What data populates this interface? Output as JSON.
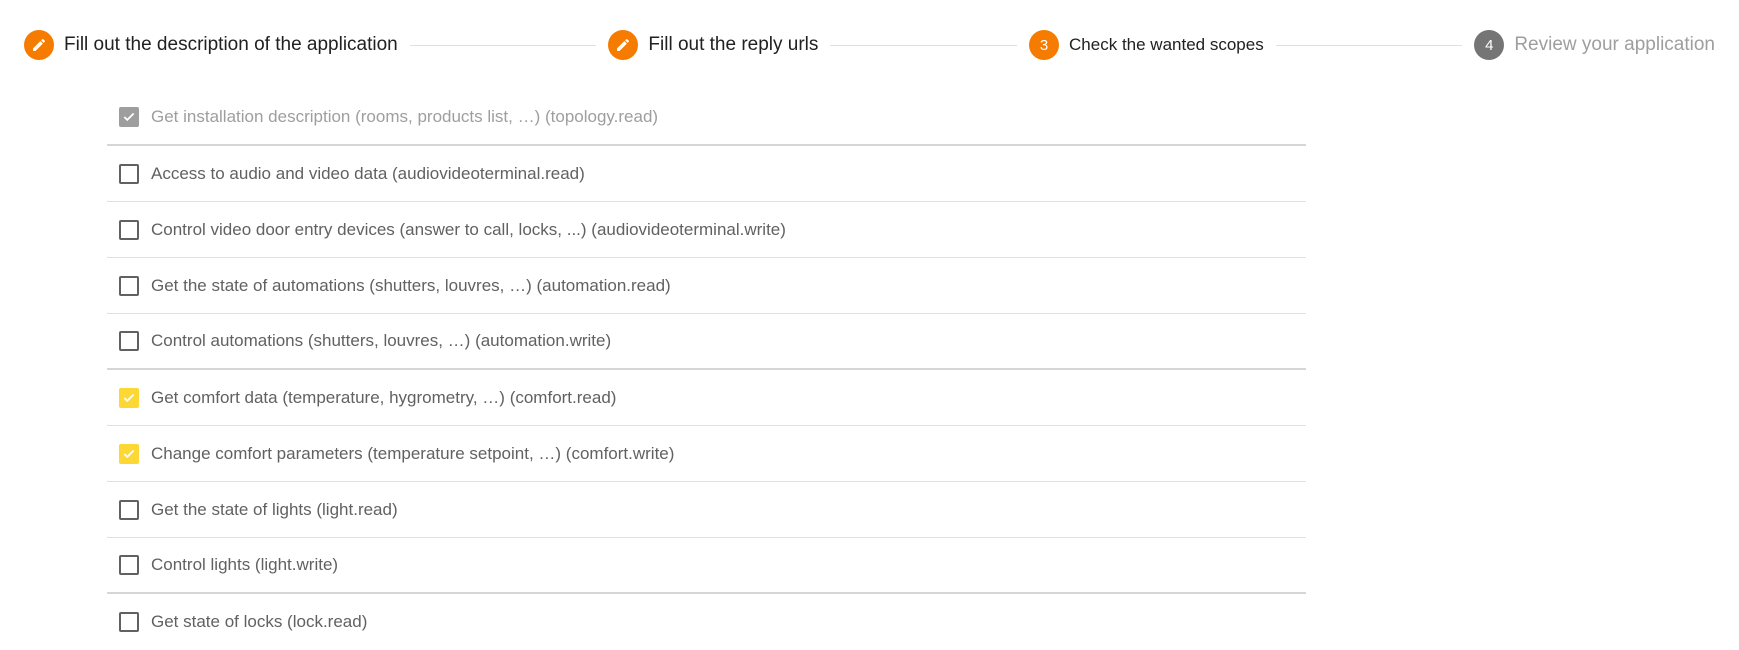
{
  "stepper": {
    "steps": [
      {
        "number": "",
        "label": "Fill out the description of the application",
        "state": "done",
        "icon": "pencil-icon"
      },
      {
        "number": "",
        "label": "Fill out the reply urls",
        "state": "done",
        "icon": "pencil-icon"
      },
      {
        "number": "3",
        "label": "Check the wanted scopes",
        "state": "active"
      },
      {
        "number": "4",
        "label": "Review your application",
        "state": "pending"
      }
    ]
  },
  "scopes": [
    {
      "label": "Get installation description (rooms, products list, …) (topology.read)",
      "checked": true,
      "disabled": true
    },
    {
      "label": "Access to audio and video data (audiovideoterminal.read)",
      "checked": false
    },
    {
      "label": "Control video door entry devices (answer to call, locks, ...) (audiovideoterminal.write)",
      "checked": false
    },
    {
      "label": "Get the state of automations (shutters, louvres, …) (automation.read)",
      "checked": false
    },
    {
      "label": "Control automations (shutters, louvres, …) (automation.write)",
      "checked": false
    },
    {
      "label": "Get comfort data (temperature, hygrometry, …) (comfort.read)",
      "checked": true
    },
    {
      "label": "Change comfort parameters (temperature setpoint, …) (comfort.write)",
      "checked": true
    },
    {
      "label": "Get the state of lights (light.read)",
      "checked": false
    },
    {
      "label": "Control lights (light.write)",
      "checked": false
    },
    {
      "label": "Get state of locks (lock.read)",
      "checked": false
    }
  ],
  "colors": {
    "accent": "#f57c00",
    "checked": "#fdd835",
    "pending": "#757575"
  }
}
